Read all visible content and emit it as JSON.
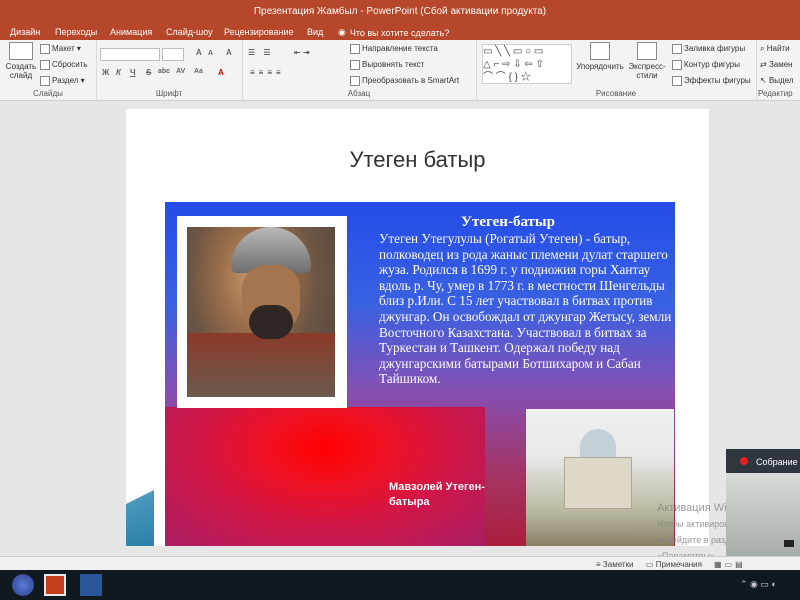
{
  "window": {
    "title": "Презентация Жамбыл - PowerPoint (Сбой активации продукта)"
  },
  "ribbon_tabs": [
    "Дизайн",
    "Переходы",
    "Анимация",
    "Слайд-шоу",
    "Рецензирование",
    "Вид"
  ],
  "tell_me": "Что вы хотите сделать?",
  "ribbon": {
    "slides": {
      "create": "Создать слайд",
      "layout": "Макет",
      "reset": "Сбросить",
      "section": "Раздел",
      "group": "Слайды"
    },
    "font": {
      "group": "Шрифт",
      "bold": "Ж",
      "italic": "К",
      "underline": "Ч",
      "strike": "S",
      "shadow": "abc",
      "spacing": "AV",
      "case": "Aa",
      "grow": "A",
      "shrink": "A",
      "clear": "A",
      "color": "A"
    },
    "paragraph": {
      "group": "Абзац",
      "text_dir": "Направление текста",
      "align_text": "Выровнять текст",
      "smartart": "Преобразовать в SmartArt"
    },
    "drawing": {
      "group": "Рисование",
      "arrange": "Упорядочить",
      "quick_styles": "Экспресс-стили",
      "fill": "Заливка фигуры",
      "outline": "Контур фигуры",
      "effects": "Эффекты фигуры"
    },
    "editing": {
      "group": "Редактир",
      "find": "Найти",
      "replace": "Замен",
      "select": "Выдел"
    }
  },
  "slide": {
    "title": "Утеген батыр",
    "heading": "Утеген-батыр",
    "body": "Утеген Утегулулы (Рогатый Утеген) - батыр, полководец из рода жаныс племени дулат старшего жуза. Родился в 1699 г. у подножия горы Хантау вдоль р. Чу, умер в 1773 г. в местности Шенгельды близ р.Или. С 15 лет участвовал в битвах против джунгар. Он освобождал от джунгар Жетысу, земли Восточного Казахстана. Участвовал в битвах за Туркестан и Ташкент. Одержал победу над джунгарскими батырами Ботшихаром и Сабан Тайшиком.",
    "caption_line1": "Мавзолей Утеген-",
    "caption_line2": "батыра"
  },
  "video": {
    "name": "Собрание"
  },
  "watermark": {
    "line1": "Активация Windows",
    "line2": "Чтобы активировать Windows,",
    "line3": "перейдите в раздел «Параметры»."
  },
  "status": {
    "notes": "Заметки",
    "comments": "Примечания"
  }
}
